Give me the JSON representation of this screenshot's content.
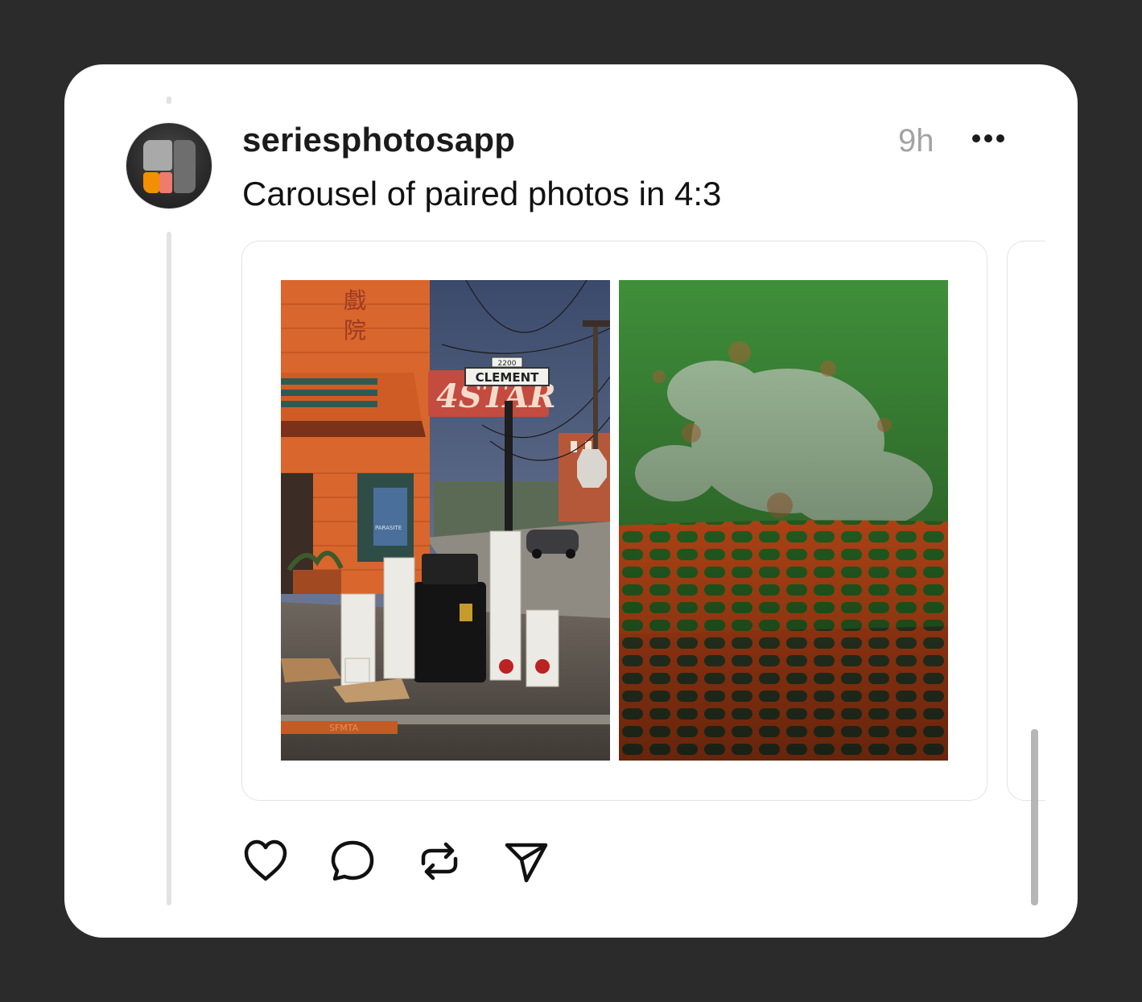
{
  "post": {
    "username": "seriesphotosapp",
    "time": "9h",
    "caption": "Carousel of paired photos in 4:3"
  },
  "photos": {
    "sign_street": "CLEMENT",
    "sign_number": "2200",
    "sign_theater": "4STAR",
    "poster": "PARASITE",
    "curb": "SFMTA"
  },
  "icons": {
    "avatar": "series-app-logo-icon",
    "more": "more-options-icon",
    "like": "heart-icon",
    "comment": "comment-bubble-icon",
    "repost": "repost-icon",
    "share": "send-icon"
  },
  "colors": {
    "background": "#2b2b2b",
    "card": "#ffffff",
    "text": "#1b1b1b",
    "muted": "#a3a3a3",
    "accent_orange": "#f29000"
  }
}
